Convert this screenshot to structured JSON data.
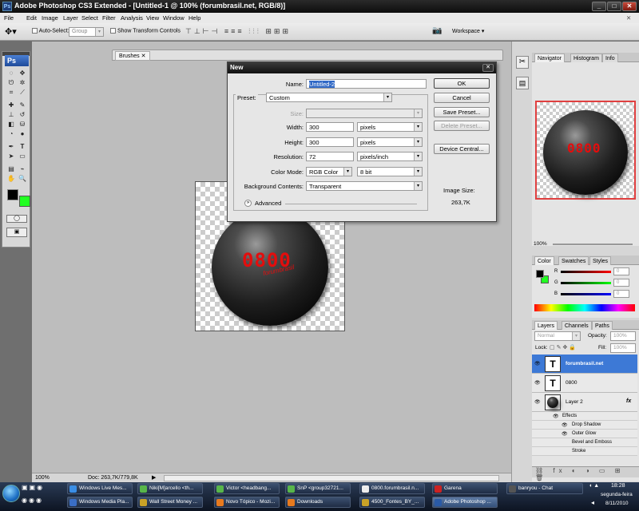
{
  "window": {
    "title": "Adobe Photoshop CS3 Extended - [Untitled-1 @ 100% (forumbrasil.net, RGB/8)]",
    "app_icon": "Ps"
  },
  "menubar": [
    "File",
    "Edit",
    "Image",
    "Layer",
    "Select",
    "Filter",
    "Analysis",
    "View",
    "Window",
    "Help"
  ],
  "options_bar": {
    "auto_select_label": "Auto-Select:",
    "auto_select_value": "Group",
    "show_transform_label": "Show Transform Controls",
    "workspace_label": "Workspace"
  },
  "toolbox": {
    "logo": "Ps",
    "fg_color": "#000000",
    "bg_color": "#22ff22"
  },
  "brushes_tab": "Brushes",
  "document": {
    "sphere_text": "0800",
    "sphere_subtext": "forumbrasil"
  },
  "status": {
    "zoom": "100%",
    "doc_info": "Doc: 263,7K/779,8K"
  },
  "dialog": {
    "title": "New",
    "name_label": "Name:",
    "name_value": "Untitled-2",
    "preset_label": "Preset:",
    "preset_value": "Custom",
    "size_label": "Size:",
    "size_value": "",
    "width_label": "Width:",
    "width_value": "300",
    "width_unit": "pixels",
    "height_label": "Height:",
    "height_value": "300",
    "height_unit": "pixels",
    "resolution_label": "Resolution:",
    "resolution_value": "72",
    "resolution_unit": "pixels/inch",
    "color_mode_label": "Color Mode:",
    "color_mode_value": "RGB Color",
    "color_depth_value": "8 bit",
    "background_label": "Background Contents:",
    "background_value": "Transparent",
    "advanced_label": "Advanced",
    "buttons": {
      "ok": "OK",
      "cancel": "Cancel",
      "save_preset": "Save Preset...",
      "delete_preset": "Delete Preset...",
      "device_central": "Device Central..."
    },
    "image_size_label": "Image Size:",
    "image_size_value": "263,7K"
  },
  "navigator": {
    "tabs": [
      "Navigator",
      "Histogram",
      "Info"
    ],
    "zoom": "100%",
    "sphere_text": "0800"
  },
  "color_panel": {
    "tabs": [
      "Color",
      "Swatches",
      "Styles"
    ],
    "r_label": "R",
    "g_label": "G",
    "b_label": "B",
    "r": "0",
    "g": "0",
    "b": "0"
  },
  "layers_panel": {
    "tabs": [
      "Layers",
      "Channels",
      "Paths"
    ],
    "blend_mode": "Normal",
    "opacity_label": "Opacity:",
    "opacity_value": "100%",
    "lock_label": "Lock:",
    "fill_label": "Fill:",
    "fill_value": "100%",
    "layers": [
      {
        "name": "forumbrasil.net",
        "type": "T",
        "selected": true
      },
      {
        "name": "0800",
        "type": "T",
        "selected": false
      },
      {
        "name": "Layer 2",
        "type": "img",
        "selected": false,
        "fx": "fx"
      }
    ],
    "effects_label": "Effects",
    "effects": [
      "Drop Shadow",
      "Outer Glow",
      "Bevel and Emboss",
      "Stroke"
    ]
  },
  "taskbar": {
    "row1": [
      "Windows Live Mes...",
      "Niki[M]arcello <th...",
      "Victor <headbang...",
      "SnP <group32721...",
      "0800.forumbrasil.n...",
      "Garena",
      "banryou - Chat"
    ],
    "row2": [
      "Windows Media Pla...",
      "Wall Street Money ...",
      "Novo Tópico - Mozi...",
      "Downloads",
      "4500_Fontes_BY_...",
      "Adobe Photoshop ..."
    ],
    "time": "18:28",
    "day": "segunda-feira",
    "date": "8/11/2010"
  }
}
